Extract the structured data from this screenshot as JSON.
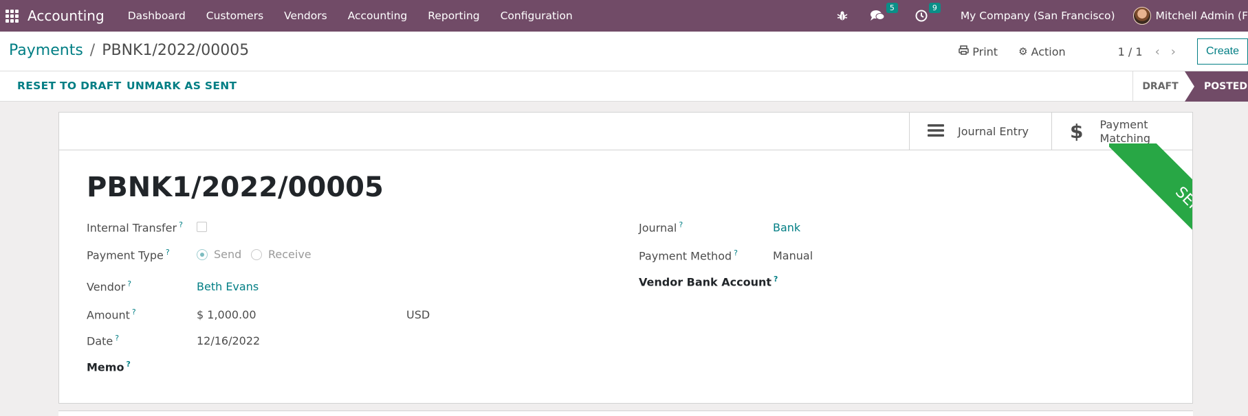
{
  "navbar": {
    "brand": "Accounting",
    "menu": [
      "Dashboard",
      "Customers",
      "Vendors",
      "Accounting",
      "Reporting",
      "Configuration"
    ],
    "messages_count": "5",
    "activities_count": "9",
    "company": "My Company (San Francisco)",
    "user": "Mitchell Admin (F"
  },
  "control_panel": {
    "breadcrumb_parent": "Payments",
    "breadcrumb_separator": "/",
    "breadcrumb_current": "PBNK1/2022/00005",
    "print_label": "Print",
    "action_label": "Action",
    "pager": "1 / 1",
    "create_label": "Create"
  },
  "status_bar": {
    "reset_label": "RESET TO DRAFT",
    "unmark_label": "UNMARK AS SENT",
    "stages": [
      "DRAFT",
      "POSTED"
    ],
    "current_stage": "POSTED"
  },
  "smart_buttons": {
    "journal_entry": "Journal Entry",
    "payment_matching_1": "Payment",
    "payment_matching_2": "Matching"
  },
  "ribbon": "SENT",
  "form": {
    "title": "PBNK1/2022/00005",
    "left": {
      "internal_transfer_label": "Internal Transfer",
      "internal_transfer_checked": false,
      "payment_type_label": "Payment Type",
      "payment_type_options": [
        "Send",
        "Receive"
      ],
      "payment_type_selected": "Send",
      "vendor_label": "Vendor",
      "vendor_value": "Beth Evans",
      "amount_label": "Amount",
      "amount_value": "$ 1,000.00",
      "currency": "USD",
      "date_label": "Date",
      "date_value": "12/16/2022",
      "memo_label": "Memo"
    },
    "right": {
      "journal_label": "Journal",
      "journal_value": "Bank",
      "payment_method_label": "Payment Method",
      "payment_method_value": "Manual",
      "vendor_bank_label": "Vendor Bank Account"
    },
    "help_mark": "?"
  },
  "colors": {
    "navbar": "#714b67",
    "link": "#017e84",
    "ribbon": "#28a745"
  }
}
